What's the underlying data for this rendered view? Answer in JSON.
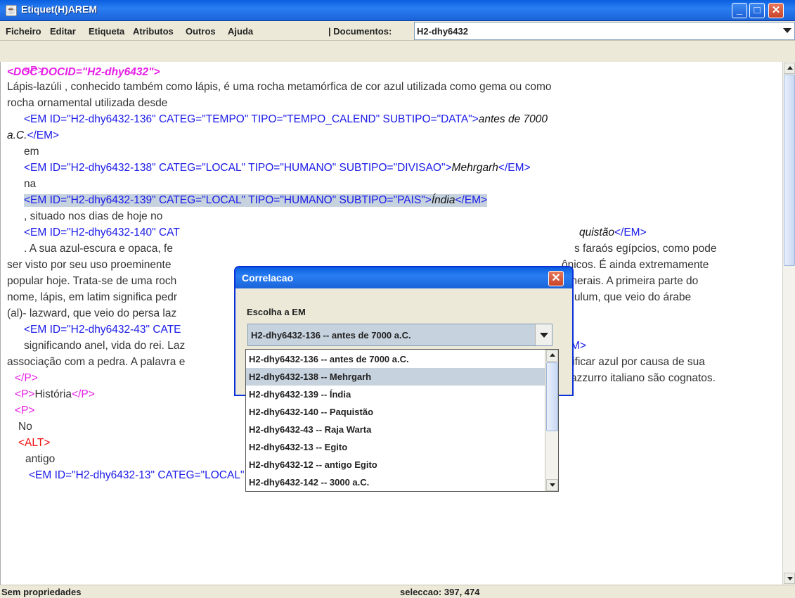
{
  "window": {
    "title": "Etiquet(H)AREM",
    "app_icon": "java-cup-icon"
  },
  "menubar": {
    "items": [
      "Ficheiro",
      "Editar",
      "Etiqueta",
      "Atributos",
      "Outros",
      "Ajuda"
    ],
    "documents_label": "| Documentos:",
    "documents_value": "H2-dhy6432"
  },
  "editor": {
    "lines": [
      {
        "parts": [
          {
            "c": "doctag",
            "t": "<DOC DOCID=\"H2-dhy6432\">"
          }
        ]
      },
      {
        "parts": [
          {
            "c": "ptag",
            "t": "<P>"
          }
        ]
      },
      {
        "parts": [
          {
            "c": "",
            "t": "Lápis-lazúli , conhecido também como lápis, é uma rocha metamórfica de cor azul utilizada como gema ou como"
          }
        ]
      },
      {
        "parts": [
          {
            "c": "",
            "t": "rocha ornamental utilizada desde"
          }
        ]
      },
      {
        "parts": [
          {
            "c": "tag",
            "t": "<EM ID=\"H2-dhy6432-136\" CATEG=\"TEMPO\" TIPO=\"TEMPO_CALEND\" SUBTIPO=\"DATA\">"
          },
          {
            "c": "it",
            "t": "antes de 7000"
          }
        ]
      },
      {
        "parts": [
          {
            "c": "it",
            "t": "a.C."
          },
          {
            "c": "tag",
            "t": "</EM>"
          }
        ]
      },
      {
        "parts": [
          {
            "c": "",
            "t": "em"
          }
        ]
      },
      {
        "parts": [
          {
            "c": "tag",
            "t": "<EM ID=\"H2-dhy6432-138\" CATEG=\"LOCAL\" TIPO=\"HUMANO\" SUBTIPO=\"DIVISAO\">"
          },
          {
            "c": "it",
            "t": "Mehrgarh"
          },
          {
            "c": "tag",
            "t": "</EM>"
          }
        ]
      },
      {
        "parts": [
          {
            "c": "",
            "t": "na"
          }
        ]
      },
      {
        "parts": [
          {
            "c": "tag",
            "t": "<EM ID=\"H2-dhy6432-139\" CATEG=\"LOCAL\" TIPO=\"HUMANO\" SUBTIPO=\"PAIS\">"
          },
          {
            "c": "it",
            "t": "Índia"
          },
          {
            "c": "tag",
            "t": "</EM>"
          }
        ]
      },
      {
        "parts": [
          {
            "c": "",
            "t": ", situado nos dias de hoje no"
          }
        ]
      },
      {
        "parts": [
          {
            "c": "tag",
            "t": "<EM ID=\"H2-dhy6432-140\" CAT"
          }
        ]
      },
      {
        "parts": [
          {
            "c": "",
            "t": ". A sua azul-escura e opaca, fe"
          }
        ]
      },
      {
        "parts": [
          {
            "c": "",
            "t": "ser visto por seu uso proeminente"
          }
        ]
      },
      {
        "parts": [
          {
            "c": "",
            "t": "popular hoje. Trata-se de uma roch"
          }
        ]
      },
      {
        "parts": [
          {
            "c": "",
            "t": "nome, lápis, em latim significa pedr"
          }
        ]
      },
      {
        "parts": [
          {
            "c": "",
            "t": "(al)- lazward, que veio do persa laz"
          }
        ]
      },
      {
        "parts": [
          {
            "c": "tag",
            "t": "<EM ID=\"H2-dhy6432-43\" CATE"
          }
        ]
      },
      {
        "parts": [
          {
            "c": "",
            "t": "significando anel, vida do rei. Laz"
          }
        ]
      },
      {
        "parts": [
          {
            "c": "",
            "t": "associação com a pedra. A palavra e"
          }
        ]
      },
      {
        "parts": [
          {
            "c": "ptag",
            "t": "</P>"
          }
        ]
      },
      {
        "parts": [
          {
            "c": "ptag",
            "t": "<P>"
          },
          {
            "c": "",
            "t": "História"
          },
          {
            "c": "ptag",
            "t": "</P>"
          }
        ]
      },
      {
        "parts": [
          {
            "c": "ptag",
            "t": "<P>"
          }
        ]
      },
      {
        "parts": [
          {
            "c": "",
            "t": "No"
          }
        ]
      },
      {
        "parts": [
          {
            "c": "rtag",
            "t": "<ALT>"
          }
        ]
      },
      {
        "parts": [
          {
            "c": "",
            "t": "antigo"
          }
        ]
      },
      {
        "parts": [
          {
            "c": "tag",
            "t": "<EM ID=\"H2-dhy6432-13\" CATEG=\"LOCAL\" TIPO=\"HUMANO\" SUBTIPO=\"PAIS\">"
          },
          {
            "c": "it",
            "t": "Egito"
          },
          {
            "c": "tag",
            "t": "</EM>"
          }
        ]
      }
    ],
    "right_fragments": [
      {
        "parts": [
          {
            "c": "it",
            "t": "quistão"
          },
          {
            "c": "tag",
            "t": "</EM>"
          }
        ]
      },
      {
        "parts": [
          {
            "c": "",
            "t": "s faraós egípcios, como pode"
          }
        ]
      },
      {
        "parts": [
          {
            "c": "",
            "t": "ônicos. É ainda extremamente"
          }
        ]
      },
      {
        "parts": [
          {
            "c": "",
            "t": "minerais. A primeira parte do"
          }
        ]
      },
      {
        "parts": [
          {
            "c": "",
            "t": "lazulum, que veio do árabe"
          }
        ]
      },
      {
        "parts": [
          {
            "c": "tag",
            "t": "M>"
          }
        ]
      },
      {
        "parts": [
          {
            "c": "",
            "t": "gnificar azul por causa de sua"
          }
        ]
      },
      {
        "parts": [
          {
            "c": "",
            "t": "azzurro italiano são cognatos."
          }
        ]
      }
    ]
  },
  "dialog": {
    "title": "Correlacao",
    "label": "Escolha a EM",
    "selected": "H2-dhy6432-136 -- antes de 7000 a.C.",
    "options": [
      "H2-dhy6432-136 -- antes de 7000 a.C.",
      "H2-dhy6432-138 -- Mehrgarh",
      "H2-dhy6432-139 -- Índia",
      "H2-dhy6432-140 -- Paquistão",
      "H2-dhy6432-43 -- Raja Warta",
      "H2-dhy6432-13 -- Egito",
      "H2-dhy6432-12 -- antigo Egito",
      "H2-dhy6432-142 -- 3000 a.C."
    ],
    "highlighted_index": 1
  },
  "status": {
    "left": "Sem propriedades",
    "right": "seleccao: 397, 474"
  }
}
